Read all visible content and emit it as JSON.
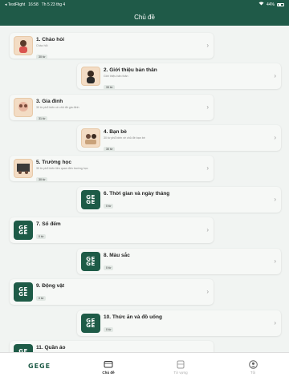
{
  "status": {
    "carrier": "◂ TestFlight",
    "time": "16:58",
    "date": "Th 5 23 thg 4",
    "battery": "44%"
  },
  "header": {
    "title": "Chủ đề"
  },
  "topics": [
    {
      "name": "1. Chào hỏi",
      "desc": "Chào hỏi",
      "count": "30 từ",
      "thumb": "photo"
    },
    {
      "name": "2. Giới thiệu bản thân",
      "desc": "Giới thiệu bản thân",
      "count": "33 từ",
      "thumb": "photo"
    },
    {
      "name": "3. Gia đình",
      "desc": "30 từ phổ biến về chủ đề gia đình",
      "count": "31 từ",
      "thumb": "photo"
    },
    {
      "name": "4. Bạn bè",
      "desc": "30 từ phổ biến về chủ đề bạn bè",
      "count": "30 từ",
      "thumb": "photo"
    },
    {
      "name": "5. Trường học",
      "desc": "30 từ phổ biến liên quan đến trường học",
      "count": "30 từ",
      "thumb": "photo"
    },
    {
      "name": "6. Thời gian và ngày tháng",
      "desc": "",
      "count": "0 từ",
      "thumb": "logo"
    },
    {
      "name": "7. Số đếm",
      "desc": "",
      "count": "0 từ",
      "thumb": "logo"
    },
    {
      "name": "8. Màu sắc",
      "desc": "",
      "count": "0 từ",
      "thumb": "logo"
    },
    {
      "name": "9. Động vật",
      "desc": "",
      "count": "0 từ",
      "thumb": "logo"
    },
    {
      "name": "10. Thức ăn và đồ uống",
      "desc": "",
      "count": "0 từ",
      "thumb": "logo"
    },
    {
      "name": "11. Quần áo",
      "desc": "",
      "count": "",
      "thumb": "logo"
    }
  ],
  "logo_text": "GEGE",
  "tabbar": {
    "brand": "GEGE",
    "tabs": [
      {
        "label": "Chủ đề",
        "icon": "book-icon",
        "active": true
      },
      {
        "label": "Từ vựng",
        "icon": "cards-icon",
        "active": false
      },
      {
        "label": "Tôi",
        "icon": "person-icon",
        "active": false
      }
    ]
  },
  "colors": {
    "primary": "#1f5a48",
    "background": "#f1f4f2",
    "card": "#f6f8f6"
  }
}
